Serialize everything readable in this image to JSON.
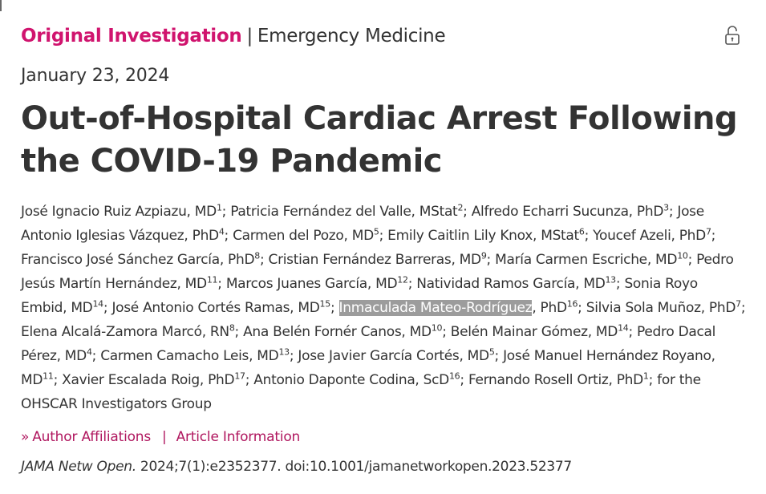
{
  "header": {
    "category": "Original Investigation",
    "separator": "|",
    "subcategory": "Emergency Medicine",
    "lock_icon": "unlocked-padlock-icon"
  },
  "pub_date": "January 23, 2024",
  "title": "Out-of-Hospital Cardiac Arrest Following the COVID-19 Pandemic",
  "authors": [
    {
      "name": "José Ignacio Ruiz Azpiazu, MD",
      "sup": "1"
    },
    {
      "name": "Patricia Fernández del Valle, MStat",
      "sup": "2"
    },
    {
      "name": "Alfredo Echarri Sucunza, PhD",
      "sup": "3"
    },
    {
      "name": "Jose Antonio Iglesias Vázquez, PhD",
      "sup": "4"
    },
    {
      "name": "Carmen del Pozo, MD",
      "sup": "5"
    },
    {
      "name": "Emily Caitlin Lily Knox, MStat",
      "sup": "6"
    },
    {
      "name": "Youcef Azeli, PhD",
      "sup": "7"
    },
    {
      "name": "Francisco José Sánchez García, PhD",
      "sup": "8"
    },
    {
      "name": "Cristian Fernández Barreras, MD",
      "sup": "9"
    },
    {
      "name": "María Carmen Escriche, MD",
      "sup": "10"
    },
    {
      "name": "Pedro Jesús Martín Hernández, MD",
      "sup": "11"
    },
    {
      "name": "Marcos Juanes García, MD",
      "sup": "12"
    },
    {
      "name": "Natividad Ramos García, MD",
      "sup": "13"
    },
    {
      "name": "Sonia Royo Embid, MD",
      "sup": "14"
    },
    {
      "name": "José Antonio Cortés Ramas, MD",
      "sup": "15"
    },
    {
      "name": "Inmaculada Mateo-Rodríguez",
      "suffix": ", PhD",
      "sup": "16",
      "highlighted": true
    },
    {
      "name": "Silvia Sola Muñoz, PhD",
      "sup": "7"
    },
    {
      "name": "Elena Alcalá-Zamora Marcó, RN",
      "sup": "8"
    },
    {
      "name": "Ana Belén Fornér Canos, MD",
      "sup": "10"
    },
    {
      "name": "Belén Mainar Gómez, MD",
      "sup": "14"
    },
    {
      "name": "Pedro Dacal Pérez, MD",
      "sup": "4"
    },
    {
      "name": "Carmen Camacho Leis, MD",
      "sup": "13"
    },
    {
      "name": "Jose Javier García Cortés, MD",
      "sup": "5"
    },
    {
      "name": "José Manuel Hernández Royano, MD",
      "sup": "11"
    },
    {
      "name": "Xavier Escalada Roig, PhD",
      "sup": "17"
    },
    {
      "name": "Antonio Daponte Codina, ScD",
      "sup": "16"
    },
    {
      "name": "Fernando Rosell Ortiz, PhD",
      "sup": "1"
    }
  ],
  "authors_group": "for the OHSCAR Investigators Group",
  "links": {
    "chevron_icon": "double-chevron-right-icon",
    "affiliations": "Author Affiliations",
    "divider": "|",
    "article_info": "Article Information"
  },
  "citation": {
    "journal": "JAMA Netw Open.",
    "details": "2024;7(1):e2352377. doi:10.1001/jamanetworkopen.2023.52377"
  }
}
